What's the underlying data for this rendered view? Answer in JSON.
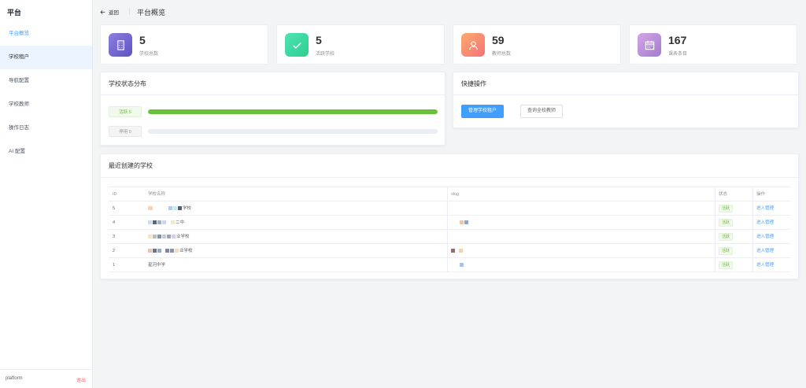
{
  "sidebar": {
    "brand": "平台",
    "items": [
      {
        "label": "平台概览",
        "state": "active"
      },
      {
        "label": "学校租户",
        "state": "hover"
      },
      {
        "label": "导航配置",
        "state": ""
      },
      {
        "label": "学校教师",
        "state": ""
      },
      {
        "label": "操作日志",
        "state": ""
      },
      {
        "label": "AI 配置",
        "state": ""
      }
    ],
    "user": "platform",
    "logout": "退出"
  },
  "header": {
    "back": "返回",
    "title": "平台概览"
  },
  "stats": [
    {
      "value": "5",
      "label": "学校总数",
      "icon": "building-icon",
      "color": "#7c6fd6"
    },
    {
      "value": "5",
      "label": "活跃学校",
      "icon": "check-icon",
      "color": "#3ad6a0"
    },
    {
      "value": "59",
      "label": "教师总数",
      "icon": "user-icon",
      "color": "#f9876b"
    },
    {
      "value": "167",
      "label": "课表条目",
      "icon": "calendar-icon",
      "color": "#b98ad8"
    }
  ],
  "distribution": {
    "title": "学校状态分布",
    "rows": [
      {
        "label": "活跃 5",
        "fraction": 1.0,
        "kind": "active"
      },
      {
        "label": "停用 0",
        "fraction": 0.0,
        "kind": "disabled"
      }
    ]
  },
  "quick": {
    "title": "快捷操作",
    "primary": "管理学校租户",
    "secondary": "查询全校教师"
  },
  "recent": {
    "title": "最近创建的学校",
    "columns": [
      "ID",
      "学校名称",
      "slug",
      "状态",
      "操作"
    ],
    "rows": [
      {
        "id": "5",
        "name": "学校",
        "status": "活跃",
        "action": "进入管理"
      },
      {
        "id": "4",
        "name": "二中",
        "status": "活跃",
        "action": "进入管理"
      },
      {
        "id": "3",
        "name": "业学校",
        "status": "活跃",
        "action": "进入管理"
      },
      {
        "id": "2",
        "name": "业学校",
        "status": "活跃",
        "action": "进入管理"
      },
      {
        "id": "1",
        "name": "星河中学",
        "status": "活跃",
        "action": "进入管理"
      }
    ]
  },
  "colors": {
    "accent": "#409eff",
    "success": "#67c23a",
    "danger": "#f56c6c"
  }
}
